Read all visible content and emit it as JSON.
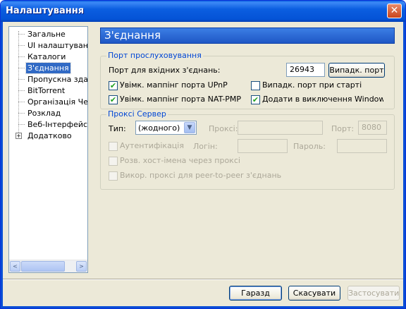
{
  "window": {
    "title": "Налаштування",
    "close_label": "✕"
  },
  "sidebar": {
    "items": [
      {
        "label": "Загальне"
      },
      {
        "label": "UI налаштування"
      },
      {
        "label": "Каталоги"
      },
      {
        "label": "З'єднання"
      },
      {
        "label": "Пропускна здатн"
      },
      {
        "label": "BitTorrent"
      },
      {
        "label": "Організація Черги"
      },
      {
        "label": "Розклад"
      },
      {
        "label": "Веб-Інтерфейс"
      },
      {
        "label": "Додатково"
      }
    ],
    "selected_index": 3,
    "expander_label": "+",
    "scroll_left": "<",
    "scroll_right": ">"
  },
  "section": {
    "title": "З'єднання"
  },
  "listen": {
    "legend": "Порт прослуховування",
    "port_label": "Порт для вхідних з'єднань:",
    "port_value": "26943",
    "random_button": "Випадк. порт",
    "upnp_label": "Увімк. маппінг порта UPnP",
    "upnp_checked": true,
    "random_start_label": "Випадк. порт при старті",
    "random_start_checked": false,
    "natpmp_label": "Увімк. маппінг порта NAT-PMP",
    "natpmp_checked": true,
    "firewall_label": "Додати в виключення Windows Fi",
    "firewall_checked": true
  },
  "proxy": {
    "legend": "Проксі Сервер",
    "type_label": "Тип:",
    "type_value": "(жодного)",
    "proxy_label": "Проксі:",
    "proxy_value": "",
    "port_label": "Порт:",
    "port_value": "8080",
    "auth_label": "Аутентифікація",
    "auth_checked": false,
    "login_label": "Логін:",
    "login_value": "",
    "password_label": "Пароль:",
    "password_value": "",
    "resolve_label": "Розв. хост-імена через проксі",
    "resolve_checked": false,
    "p2p_label": "Викор. проксі для peer-to-peer з'єднань",
    "p2p_checked": false
  },
  "footer": {
    "ok": "Гаразд",
    "cancel": "Скасувати",
    "apply": "Застосувати"
  },
  "colors": {
    "titlebar": "#0a5fe0",
    "header": "#2e6ad8",
    "selection": "#316ac5",
    "group_legend": "#0046d5"
  }
}
